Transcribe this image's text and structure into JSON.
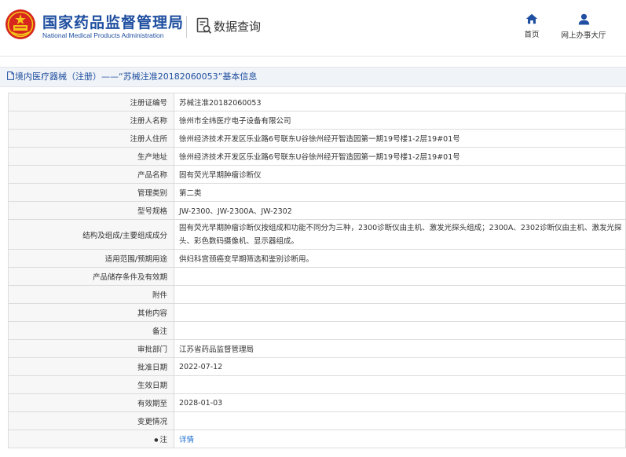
{
  "header": {
    "org_name_cn": "国家药品监督管理局",
    "org_name_en": "National Medical Products Administration",
    "query_label": "数据查询",
    "nav": {
      "home_label": "首页",
      "online_hall_label": "网上办事大厅"
    }
  },
  "breadcrumb": {
    "text": "境内医疗器械（注册）——“苏械注准20182060053”基本信息"
  },
  "detail": {
    "rows": [
      {
        "label": "注册证编号",
        "value": "苏械注准20182060053"
      },
      {
        "label": "注册人名称",
        "value": "徐州市全纬医疗电子设备有限公司"
      },
      {
        "label": "注册人住所",
        "value": "徐州经济技术开发区乐业路6号联东U谷徐州经开智造园第一期19号楼1-2层19#01号"
      },
      {
        "label": "生产地址",
        "value": "徐州经济技术开发区乐业路6号联东U谷徐州经开智造园第一期19号楼1-2层19#01号"
      },
      {
        "label": "产品名称",
        "value": "固有荧光早期肿瘤诊断仪"
      },
      {
        "label": "管理类别",
        "value": "第二类"
      },
      {
        "label": "型号规格",
        "value": "JW-2300、JW-2300A、JW-2302"
      },
      {
        "label": "结构及组成/主要组成成分",
        "value": "固有荧光早期肿瘤诊断仪按组成和功能不同分为三种，2300诊断仪由主机、激发光探头组成；2300A、2302诊断仪由主机、激发光探头、彩色数码摄像机、显示器组成。"
      },
      {
        "label": "适用范围/预期用途",
        "value": "供妇科宫颈癌变早期筛选和鉴别诊断用。"
      },
      {
        "label": "产品储存条件及有效期",
        "value": ""
      },
      {
        "label": "附件",
        "value": ""
      },
      {
        "label": "其他内容",
        "value": ""
      },
      {
        "label": "备注",
        "value": ""
      },
      {
        "label": "审批部门",
        "value": "江苏省药品监督管理局"
      },
      {
        "label": "批准日期",
        "value": "2022-07-12"
      },
      {
        "label": "生效日期",
        "value": ""
      },
      {
        "label": "有效期至",
        "value": "2028-01-03"
      },
      {
        "label": "变更情况",
        "value": ""
      },
      {
        "label": "注",
        "value": "详情"
      }
    ]
  },
  "colors": {
    "brand_blue": "#1f4fa0",
    "emblem_red": "#d7261e",
    "emblem_gold": "#f5c518",
    "link_blue": "#1f6fd0"
  },
  "icons": [
    "emblem-logo",
    "data-query-icon",
    "home-icon",
    "user-icon",
    "document-icon",
    "bullet-icon"
  ]
}
